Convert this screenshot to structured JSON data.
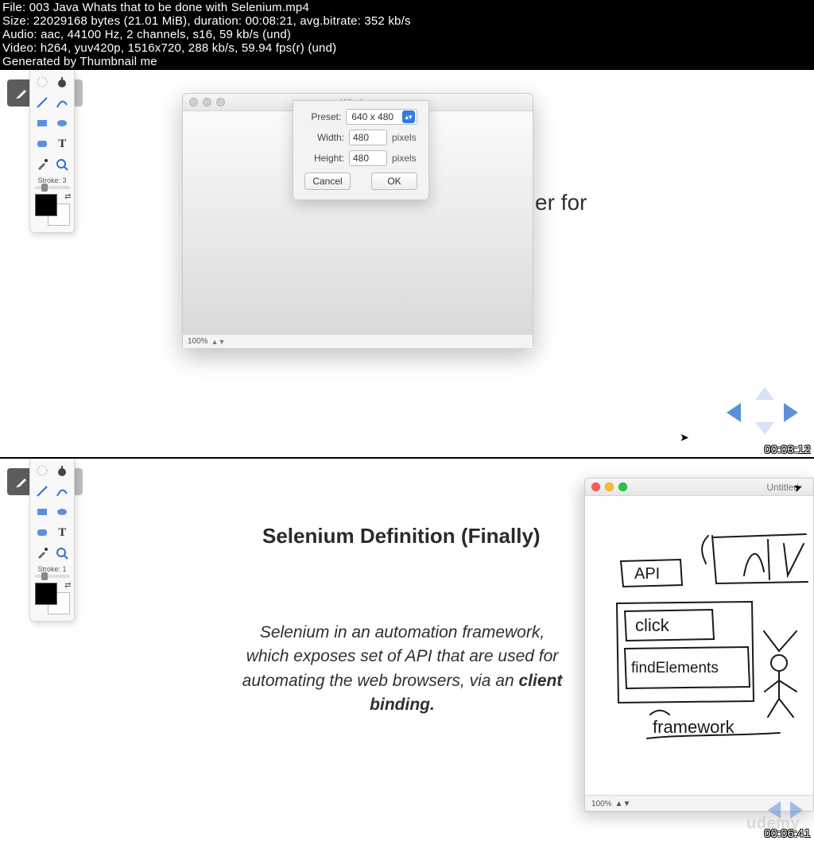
{
  "header": {
    "file": "File: 003 Java Whats that to be done with Selenium.mp4",
    "size": "Size: 22029168 bytes (21.01 MiB), duration: 00:08:21, avg.bitrate: 352 kb/s",
    "audio": "Audio: aac, 44100 Hz, 2 channels, s16, 59 kb/s (und)",
    "video": "Video: h264, yuv420p, 1516x720, 288 kb/s, 59.94 fps(r) (und)",
    "generated": "Generated by Thumbnail me"
  },
  "frame1": {
    "timestamp": "00:03:12",
    "toolbox": {
      "stroke_label": "Stroke: 3"
    },
    "window": {
      "title": "Window",
      "preset_label": "Preset:",
      "preset_value": "640 x 480",
      "width_label": "Width:",
      "width_value": "480",
      "height_label": "Height:",
      "height_value": "480",
      "pixels": "pixels",
      "cancel": "Cancel",
      "ok": "OK",
      "zoom": "100%"
    },
    "bg_text": "er for"
  },
  "frame2": {
    "timestamp": "00:06:41",
    "toolbox": {
      "stroke_label": "Stroke: 1"
    },
    "slide": {
      "title": "Selenium Definition (Finally)",
      "body_line1": "Selenium in an automation framework,",
      "body_line2": "which exposes set of API that are used for",
      "body_line3": "automating the web browsers, via an ",
      "bold1": "client",
      "bold2": "binding."
    },
    "sketch": {
      "title": "Untitled",
      "zoom": "100%",
      "labels": {
        "api": "API",
        "click": "click",
        "find": "findElements",
        "framework": "framework"
      }
    },
    "watermark": "udemy"
  }
}
